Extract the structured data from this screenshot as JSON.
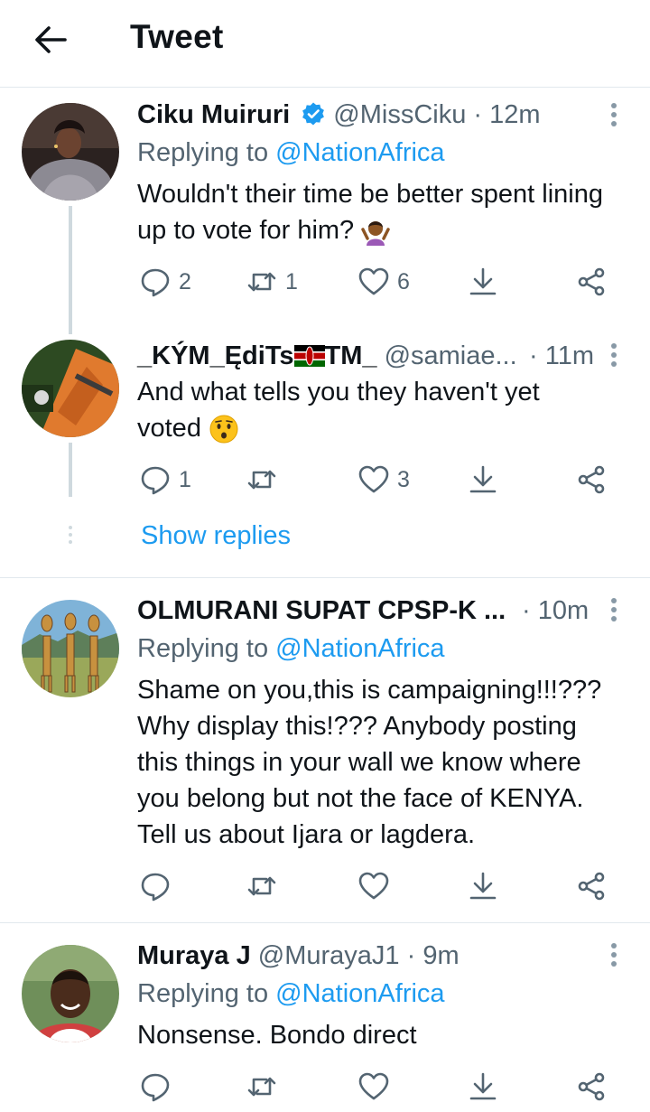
{
  "header": {
    "title": "Tweet"
  },
  "tweets": [
    {
      "name": "Ciku Muiruri",
      "verified": true,
      "handle": "@MissCiku",
      "time": "· 12m",
      "replying_prefix": "Replying to ",
      "replying_handle": "@NationAfrica",
      "text": "Wouldn't their time be better spent lining up to vote for him?",
      "emoji": "person-shrugging-emoji",
      "replies": "2",
      "retweets": "1",
      "likes": "6"
    },
    {
      "name": "_KÝM_ĘdiTs",
      "name_suffix": "TM_",
      "flag": "kenya-flag-icon",
      "handle": "@samiae...",
      "time": "· 11m",
      "text": "And what tells you they haven't yet voted",
      "emoji": "hushed-face-emoji",
      "replies": "1",
      "retweets": "",
      "likes": "3"
    },
    {
      "name": "OLMURANI SUPAT CPSP-K ...",
      "handle": "",
      "time": "· 10m",
      "replying_prefix": "Replying to ",
      "replying_handle": "@NationAfrica",
      "text_lines": [
        "Shame on you,this is campaigning!!!???",
        "Why display this!??? Anybody posting",
        "this things in your wall we know where",
        "you belong but not the face of KENYA.",
        "Tell us about Ijara or lagdera."
      ],
      "replies": "",
      "retweets": "",
      "likes": ""
    },
    {
      "name": "Muraya J",
      "handle": "@MurayaJ1",
      "time": "· 9m",
      "replying_prefix": "Replying to ",
      "replying_handle": "@NationAfrica",
      "text": "Nonsense. Bondo direct",
      "replies": "",
      "retweets": "",
      "likes": ""
    }
  ],
  "show_replies": "Show replies",
  "colors": {
    "accent": "#1d9bf0",
    "muted": "#536471",
    "line": "#cfd9de"
  }
}
